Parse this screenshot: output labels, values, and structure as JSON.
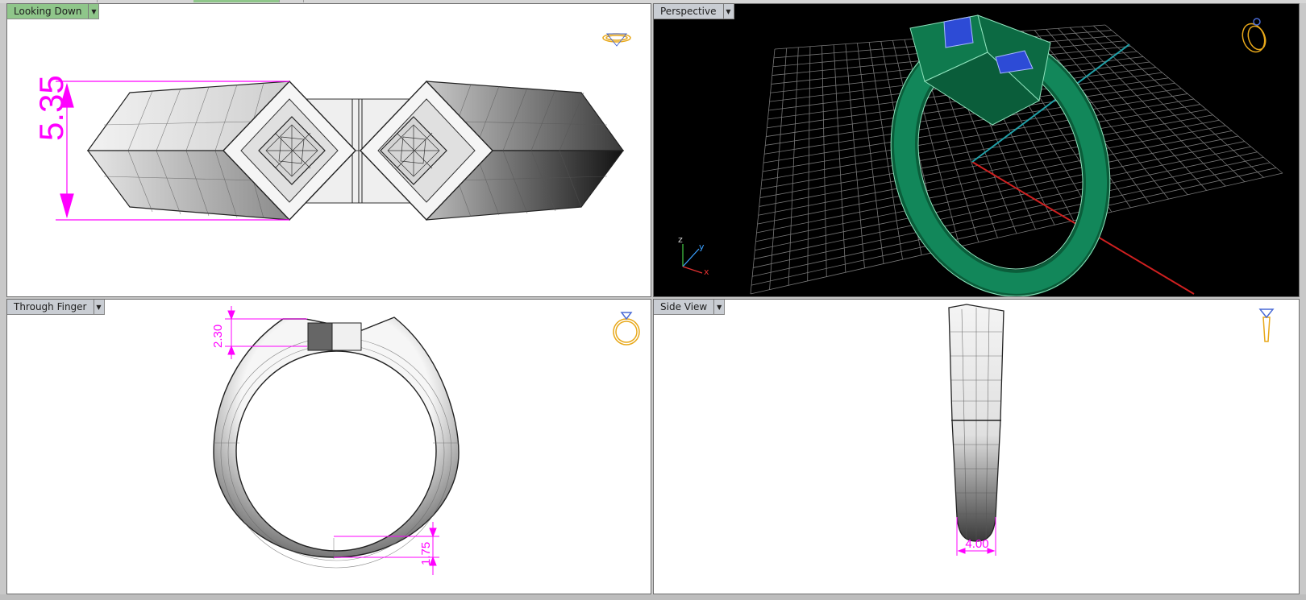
{
  "viewports": {
    "top_left": {
      "label": "Looking Down",
      "dimension": "5.35"
    },
    "top_right": {
      "label": "Perspective",
      "axes": {
        "z": "z",
        "y": "y",
        "x": "x"
      }
    },
    "bottom_left": {
      "label": "Through Finger",
      "dim_a": "2.30",
      "dim_b": "1.75"
    },
    "bottom_right": {
      "label": "Side View",
      "dimension": "4.00"
    }
  },
  "icons": {
    "viewport_menu": "dropdown-arrow-icon",
    "nav_gizmo": "ring-gizmo-icon"
  },
  "colors": {
    "active_tab": "#8fc68a",
    "dimension": "#ff00ff",
    "ring_green": "#0f7a4e",
    "gem_blue": "#2d4bd6",
    "gizmo": "#e8a81a"
  }
}
